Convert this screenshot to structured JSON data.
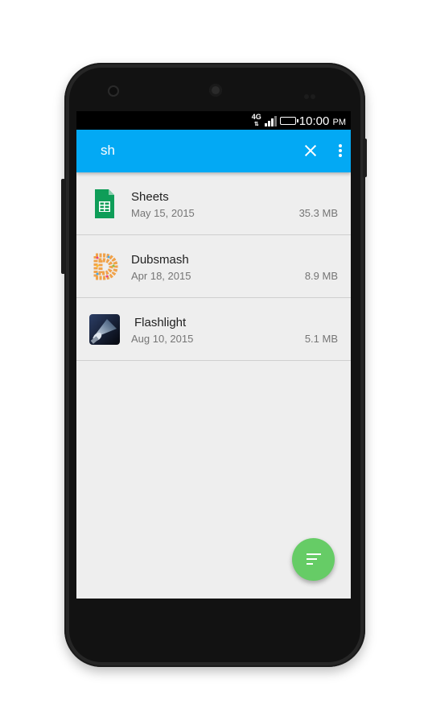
{
  "status_bar": {
    "network": "4G",
    "network_sub": "LTE",
    "time": "10:00",
    "ampm": "PM"
  },
  "app_bar": {
    "search_query": "sh",
    "color": "#03a9f4",
    "close_icon": "close-icon",
    "menu_icon": "more-vert-icon"
  },
  "results": [
    {
      "name": "Sheets",
      "date": "May 15, 2015",
      "size": "35.3 MB",
      "icon": "sheets-icon"
    },
    {
      "name": "Dubsmash",
      "date": "Apr 18, 2015",
      "size": "8.9 MB",
      "icon": "dubsmash-icon"
    },
    {
      "name": "Flashlight",
      "date": "Aug 10, 2015",
      "size": "5.1 MB",
      "icon": "flashlight-icon"
    }
  ],
  "fab": {
    "icon": "sort-icon",
    "color": "#66cc66"
  }
}
